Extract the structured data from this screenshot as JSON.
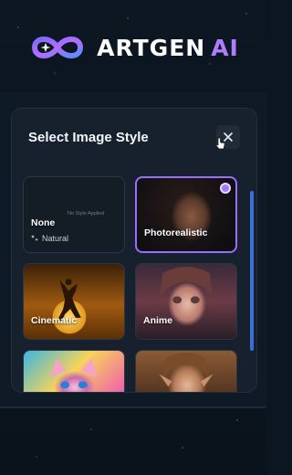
{
  "brand": {
    "name": "ARTGEN",
    "suffix": "AI",
    "accent": "#b07cff"
  },
  "modal": {
    "title": "Select Image Style"
  },
  "styles": [
    {
      "label": "None",
      "sub_label": "Natural",
      "hint": "No Style Applied",
      "selected": false
    },
    {
      "label": "Photorealistic",
      "selected": true
    },
    {
      "label": "Cinematic",
      "selected": false
    },
    {
      "label": "Anime",
      "selected": false
    },
    {
      "label": "",
      "selected": false
    },
    {
      "label": "",
      "selected": false
    }
  ],
  "icons": {
    "logo": "infinity-logo-icon",
    "close": "close-icon",
    "selected": "check-dot-icon",
    "natural": "sparkle-icon",
    "cursor": "pointer-cursor-icon"
  },
  "colors": {
    "selection": "#9b6dff",
    "scrollbar": "#3b6fd6"
  }
}
